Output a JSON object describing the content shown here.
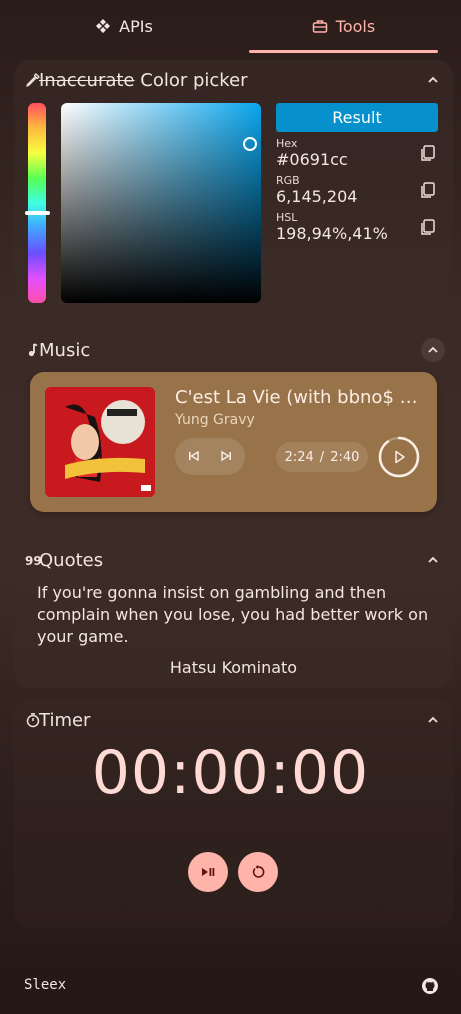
{
  "tabs": [
    {
      "label": "APIs",
      "icon": "api-icon",
      "active": false
    },
    {
      "label": "Tools",
      "icon": "toolbox-icon",
      "active": true
    }
  ],
  "color_picker": {
    "title_struck": "Inaccurate",
    "title": "Color picker",
    "result_label": "Result",
    "hex_label": "Hex",
    "hex_value": "#0691cc",
    "rgb_label": "RGB",
    "rgb_value": "6,145,204",
    "hsl_label": "HSL",
    "hsl_value": "198,94%,41%",
    "color": "#0691cc"
  },
  "music": {
    "title": "Music",
    "song": "C'est La Vie (with bbno$ & Rich Brian)",
    "artist": "Yung Gravy",
    "position": "2:24",
    "separator": "/",
    "duration": "2:40",
    "progress": 0.9
  },
  "quotes": {
    "title": "Quotes",
    "text": "If you're gonna insist on gambling and then complain when you lose, you had better work on your game.",
    "author": "Hatsu Kominato"
  },
  "timer": {
    "title": "Timer",
    "display": "00:00:00"
  },
  "footer": {
    "brand": "Sleex"
  },
  "colors": {
    "accent": "#ffb4aa",
    "music_card": "#987349",
    "result_button": "#0691cc"
  }
}
